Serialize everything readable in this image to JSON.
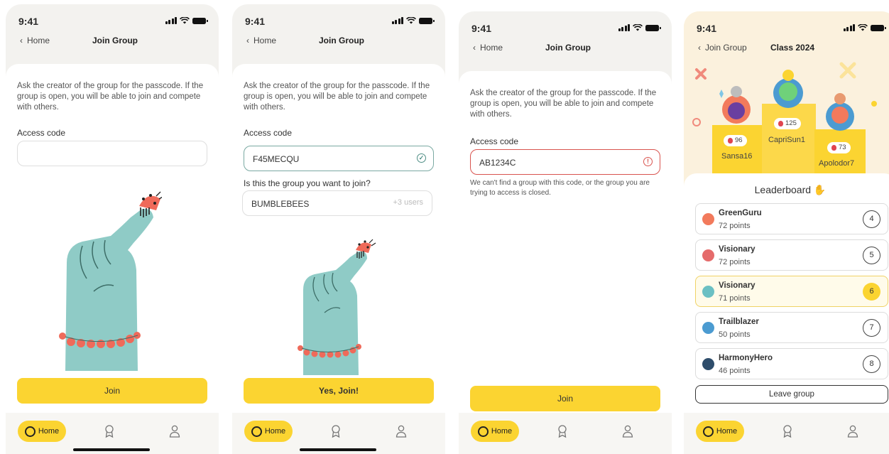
{
  "status_time": "9:41",
  "common": {
    "back_label": "Home",
    "join_group_title": "Join Group",
    "info_text": "Ask the creator of the group for the passcode. If the group is open, you will be able to join and compete with others.",
    "access_code_label": "Access code",
    "tab_home": "Home"
  },
  "screen2": {
    "code_value": "F45MECQU",
    "confirm_question": "Is this the group you want to join?",
    "group_name": "BUMBLEBEES",
    "group_users": "+3 users",
    "confirm_button": "Yes, Join!"
  },
  "screen3": {
    "code_value": "AB1234C",
    "error_message": "We can't find a group with this code, or the group you are trying to access is closed."
  },
  "join_button": "Join",
  "screen4": {
    "back_label": "Join Group",
    "title": "Class 2024",
    "podium": [
      {
        "name": "Sansa16",
        "score": "96",
        "place": 2
      },
      {
        "name": "CapriSun1",
        "score": "125",
        "place": 1
      },
      {
        "name": "Apolodor7",
        "score": "73",
        "place": 3
      }
    ],
    "leaderboard_title": "Leaderboard",
    "rows": [
      {
        "name": "GreenGuru",
        "points": "72 points",
        "rank": "4",
        "avatar_color": "#f27a5c"
      },
      {
        "name": "Visionary",
        "points": "72 points",
        "rank": "5",
        "avatar_color": "#e56b6b"
      },
      {
        "name": "Visionary",
        "points": "71 points",
        "rank": "6",
        "avatar_color": "#6bc0c3"
      },
      {
        "name": "Trailblazer",
        "points": "50 points",
        "rank": "7",
        "avatar_color": "#4b9bd1"
      },
      {
        "name": "HarmonyHero",
        "points": "46 points",
        "rank": "8",
        "avatar_color": "#2e4d6b"
      }
    ],
    "leave_button": "Leave group"
  },
  "colors": {
    "accent_yellow": "#fbd431",
    "hand_teal": "#8fcbc6",
    "bracelet_coral": "#ef6a5a",
    "error_red": "#d9544f"
  }
}
